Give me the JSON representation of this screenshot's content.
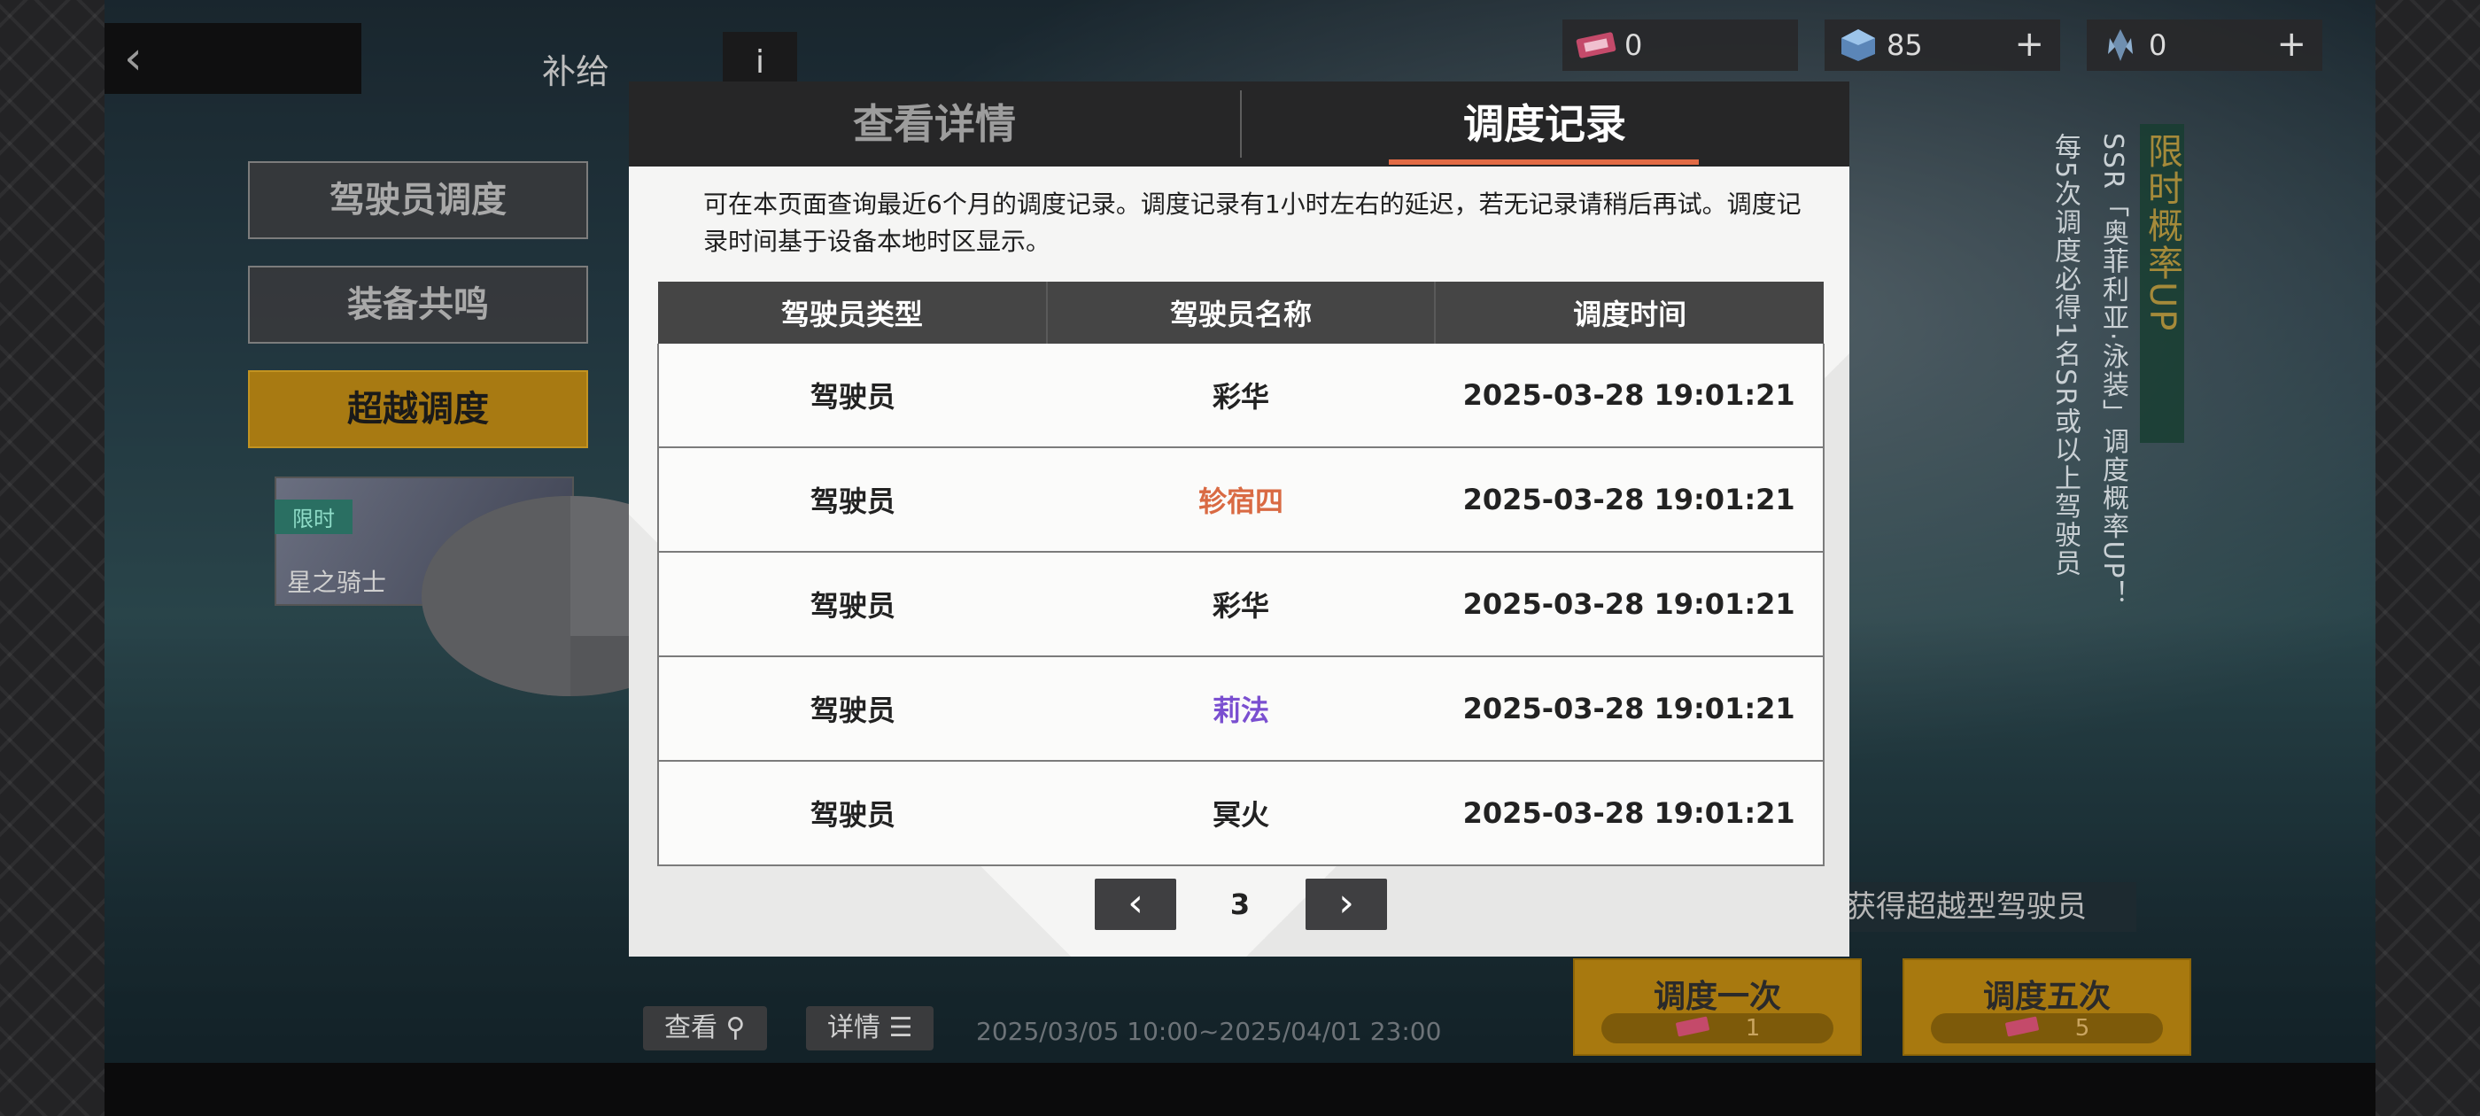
{
  "topbar": {
    "title": "补给",
    "info_label": "i",
    "resources": [
      {
        "icon": "ticket-icon",
        "value": "0",
        "has_plus": false
      },
      {
        "icon": "crystal-cube-icon",
        "value": "85",
        "has_plus": true
      },
      {
        "icon": "crystal-shard-icon",
        "value": "0",
        "has_plus": true
      }
    ]
  },
  "menu": {
    "items": [
      "驾驶员调度",
      "装备共鸣",
      "超越调度"
    ],
    "active": "超越调度"
  },
  "banner": {
    "tag": "限时",
    "name": "星之骑士"
  },
  "event": {
    "gain_label": "获得超越型驾驶员",
    "vertical_line1": "每5次调度必得1名SR或以上驾驶员",
    "vertical_line2": "SSR「奥菲利亚·泳装」调度概率UP！",
    "vertical_line3": "限时概率UP",
    "view_label": "查看",
    "detail_label": "详情",
    "date_range": "2025/03/05 10:00~2025/04/01 23:00",
    "pull_once_label": "调度一次",
    "pull_once_cost": "1",
    "pull_five_label": "调度五次",
    "pull_five_cost": "5"
  },
  "modal": {
    "tabs": [
      "查看详情",
      "调度记录"
    ],
    "active_tab": "调度记录",
    "notice": "可在本页面查询最近6个月的调度记录。调度记录有1小时左右的延迟，若无记录请稍后再试。调度记录时间基于设备本地时区显示。",
    "columns": [
      "驾驶员类型",
      "驾驶员名称",
      "调度时间"
    ],
    "rows": [
      {
        "type": "驾驶员",
        "name": "彩华",
        "time": "2025-03-28 19:01:21",
        "name_color": "#222222"
      },
      {
        "type": "驾驶员",
        "name": "轸宿四",
        "time": "2025-03-28 19:01:21",
        "name_color": "#d96a43"
      },
      {
        "type": "驾驶员",
        "name": "彩华",
        "time": "2025-03-28 19:01:21",
        "name_color": "#222222"
      },
      {
        "type": "驾驶员",
        "name": "莉法",
        "time": "2025-03-28 19:01:21",
        "name_color": "#7a4fd0"
      },
      {
        "type": "驾驶员",
        "name": "冥火",
        "time": "2025-03-28 19:01:21",
        "name_color": "#222222"
      }
    ],
    "pager": {
      "page": "3",
      "prev_icon": "chevron-left-icon",
      "next_icon": "chevron-right-icon"
    }
  },
  "colors": {
    "accent": "#e26b45",
    "active_menu": "#a87a12",
    "rare_orange": "#d96a43",
    "rare_purple": "#7a4fd0"
  }
}
